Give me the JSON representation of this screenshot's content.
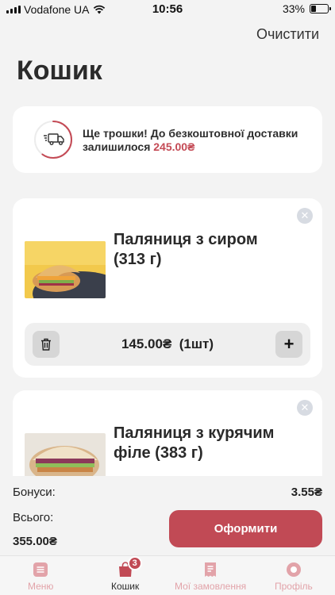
{
  "status_bar": {
    "carrier": "Vodafone UA",
    "time": "10:56",
    "battery_percent": "33%",
    "battery_level": 0.33
  },
  "header": {
    "clear_label": "Очистити",
    "title": "Кошик"
  },
  "delivery_notice": {
    "text": "Ще трошки! До безкоштовної доставки залишилося",
    "amount": "245.00₴",
    "progress": 0.6,
    "accent_color": "#c44a55"
  },
  "cart_items": [
    {
      "name": "Паляниця з сиром (313 г)",
      "price": "145.00₴",
      "quantity": "(1шт)"
    },
    {
      "name": "Паляниця з курячим філе (383 г)"
    }
  ],
  "summary": {
    "bonus_label": "Бонуси:",
    "bonus_value": "3.55₴",
    "total_label": "Всього:",
    "total_value": "355.00₴",
    "checkout_label": "Оформити"
  },
  "tabs": [
    {
      "label": "Меню",
      "icon": "menu-icon"
    },
    {
      "label": "Кошик",
      "icon": "cart-bag-icon",
      "badge": "3",
      "active": true
    },
    {
      "label": "Мої замовлення",
      "icon": "receipt-icon"
    },
    {
      "label": "Профіль",
      "icon": "profile-icon"
    }
  ],
  "colors": {
    "accent": "#c14a55",
    "inactive_tab": "#e2a3a9",
    "background": "#f3f3f3"
  }
}
